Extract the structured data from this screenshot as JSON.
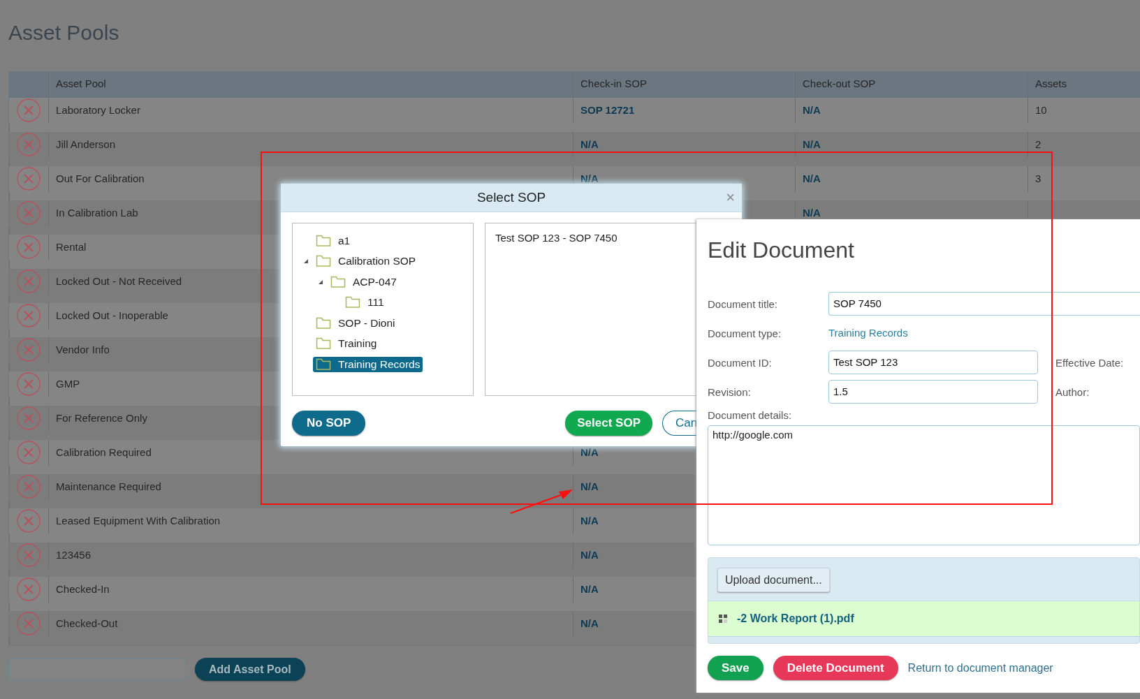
{
  "page": {
    "title": "Asset Pools"
  },
  "table": {
    "columns": [
      "Asset Pool",
      "Check-in SOP",
      "Check-out SOP",
      "Assets"
    ],
    "rows": [
      {
        "name": "Laboratory Locker",
        "checkin": "SOP 12721",
        "checkout": "N/A",
        "assets": "10"
      },
      {
        "name": "Jill Anderson",
        "checkin": "N/A",
        "checkout": "N/A",
        "assets": "2"
      },
      {
        "name": "Out For Calibration",
        "checkin": "N/A",
        "checkout": "N/A",
        "assets": "3"
      },
      {
        "name": "In Calibration Lab",
        "checkout": "N/A"
      },
      {
        "name": "Rental"
      },
      {
        "name": "Locked Out - Not Received"
      },
      {
        "name": "Locked Out - Inoperable"
      },
      {
        "name": "Vendor Info"
      },
      {
        "name": "GMP"
      },
      {
        "name": "For Reference Only"
      },
      {
        "name": "Calibration Required",
        "checkin": "N/A"
      },
      {
        "name": "Maintenance Required",
        "checkin": "N/A"
      },
      {
        "name": "Leased Equipment With Calibration",
        "checkin": "N/A"
      },
      {
        "name": "123456",
        "checkin": "N/A"
      },
      {
        "name": "Checked-In",
        "checkin": "N/A"
      },
      {
        "name": "Checked-Out",
        "checkin": "N/A"
      }
    ]
  },
  "add_pool": {
    "button": "Add Asset Pool"
  },
  "select_sop_dialog": {
    "title": "Select SOP",
    "close": "×",
    "tree": [
      {
        "label": "a1",
        "expanded": false,
        "selected": false
      },
      {
        "label": "Calibration SOP",
        "expanded": true,
        "selected": false,
        "children": [
          {
            "label": "ACP-047",
            "expanded": true,
            "selected": false,
            "children": [
              {
                "label": "111",
                "expanded": false,
                "selected": false
              }
            ]
          }
        ]
      },
      {
        "label": "SOP - Dioni",
        "expanded": false,
        "selected": false
      },
      {
        "label": "Training",
        "expanded": false,
        "selected": false
      },
      {
        "label": "Training Records",
        "expanded": false,
        "selected": true
      }
    ],
    "documents": [
      "Test SOP 123 - SOP 7450"
    ],
    "buttons": [
      {
        "label": "No SOP",
        "kind": "secondary"
      },
      {
        "label": "Select SOP",
        "kind": "primary"
      },
      {
        "label": "Can",
        "kind": "outline"
      }
    ]
  },
  "edit_document": {
    "title": "Edit Document",
    "fields": [
      {
        "label": "Document title:",
        "value": "SOP 7450",
        "kind": "wide-input"
      },
      {
        "label": "Document type:",
        "value": "Training Records",
        "kind": "link"
      },
      {
        "label": "Document ID:",
        "value": "Test SOP 123",
        "kind": "input",
        "side_label": "Effective Date:"
      },
      {
        "label": "Revision:",
        "value": "1.5",
        "kind": "input",
        "side_label": "Author:"
      }
    ],
    "details_label": "Document details:",
    "details": "http://google.com",
    "upload_button": "Upload document...",
    "file": "-2 Work Report (1).pdf",
    "buttons": [
      {
        "label": "Save",
        "kind": "save"
      },
      {
        "label": "Delete Document",
        "kind": "delete"
      }
    ],
    "link": "Return to document manager"
  }
}
